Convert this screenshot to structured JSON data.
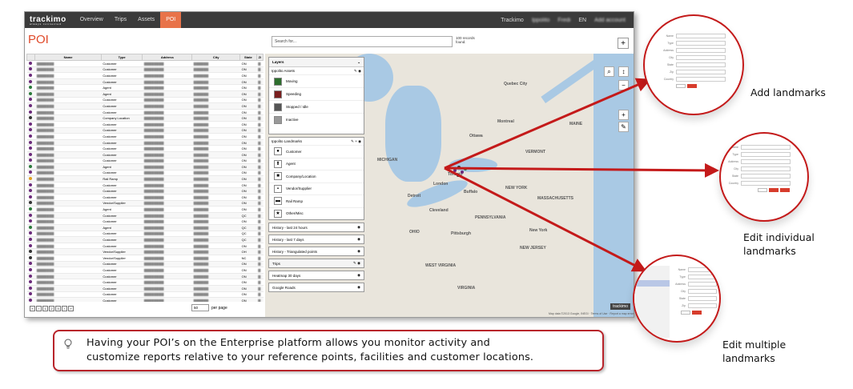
{
  "app": {
    "logo": "trackimo",
    "logo_sub": "always connected",
    "nav": [
      "Overview",
      "Trips",
      "Assets",
      "POI"
    ],
    "topbar_right": [
      "Trackimo",
      "Ippolito",
      "Fredi",
      "EN",
      "Add account"
    ],
    "page_title": "POI",
    "search_placeholder": "Search for...",
    "records": "100 records found.",
    "add_label": "+"
  },
  "table": {
    "headers": [
      "",
      "Name",
      "Type",
      "Address",
      "City",
      "State",
      "Zi"
    ],
    "rows": [
      {
        "color": "#6b2a7a",
        "type": "Customer",
        "state": "ON"
      },
      {
        "color": "#6b2a7a",
        "type": "Customer",
        "state": "ON"
      },
      {
        "color": "#6b2a7a",
        "type": "Customer",
        "state": "ON"
      },
      {
        "color": "#6b2a7a",
        "type": "Customer",
        "state": "ON"
      },
      {
        "color": "#2a7a3a",
        "type": "Agent",
        "state": "ON"
      },
      {
        "color": "#2a7a3a",
        "type": "Agent",
        "state": "ON"
      },
      {
        "color": "#6b2a7a",
        "type": "Customer",
        "state": "ON"
      },
      {
        "color": "#6b2a7a",
        "type": "Customer",
        "state": "ON"
      },
      {
        "color": "#6b2a7a",
        "type": "Customer",
        "state": "ON"
      },
      {
        "color": "#333333",
        "type": "Company Location",
        "state": "ON"
      },
      {
        "color": "#6b2a7a",
        "type": "Customer",
        "state": "ON"
      },
      {
        "color": "#6b2a7a",
        "type": "Customer",
        "state": "ON"
      },
      {
        "color": "#6b2a7a",
        "type": "Customer",
        "state": "ON"
      },
      {
        "color": "#6b2a7a",
        "type": "Customer",
        "state": "ON"
      },
      {
        "color": "#6b2a7a",
        "type": "Customer",
        "state": "ON"
      },
      {
        "color": "#6b2a7a",
        "type": "Customer",
        "state": "ON"
      },
      {
        "color": "#6b2a7a",
        "type": "Customer",
        "state": "ON"
      },
      {
        "color": "#2a7a3a",
        "type": "Agent",
        "state": "ON"
      },
      {
        "color": "#6b2a7a",
        "type": "Customer",
        "state": "ON"
      },
      {
        "color": "#e2a020",
        "type": "Rail Ramp",
        "state": "ON"
      },
      {
        "color": "#6b2a7a",
        "type": "Customer",
        "state": "ON"
      },
      {
        "color": "#6b2a7a",
        "type": "Customer",
        "state": "ON"
      },
      {
        "color": "#6b2a7a",
        "type": "Customer",
        "state": "ON"
      },
      {
        "color": "#333333",
        "type": "Vendor/Supplier",
        "state": "ON"
      },
      {
        "color": "#2a7a3a",
        "type": "Agent",
        "state": "ON"
      },
      {
        "color": "#6b2a7a",
        "type": "Customer",
        "state": "QC"
      },
      {
        "color": "#6b2a7a",
        "type": "Customer",
        "state": "ON"
      },
      {
        "color": "#2a7a3a",
        "type": "Agent",
        "state": "QC"
      },
      {
        "color": "#6b2a7a",
        "type": "Customer",
        "state": "QC"
      },
      {
        "color": "#6b2a7a",
        "type": "Customer",
        "state": "QC"
      },
      {
        "color": "#6b2a7a",
        "type": "Customer",
        "state": "ON"
      },
      {
        "color": "#333333",
        "type": "Vendor/Supplier",
        "state": "OH"
      },
      {
        "color": "#333333",
        "type": "Vendor/Supplier",
        "state": "NC"
      },
      {
        "color": "#6b2a7a",
        "type": "Customer",
        "state": "ON"
      },
      {
        "color": "#6b2a7a",
        "type": "Customer",
        "state": "ON"
      },
      {
        "color": "#6b2a7a",
        "type": "Customer",
        "state": "ON"
      },
      {
        "color": "#6b2a7a",
        "type": "Customer",
        "state": "ON"
      },
      {
        "color": "#6b2a7a",
        "type": "Customer",
        "state": "ON"
      },
      {
        "color": "#6b2a7a",
        "type": "Customer",
        "state": "ON"
      },
      {
        "color": "#6b2a7a",
        "type": "Customer",
        "state": "ON"
      }
    ]
  },
  "pager": {
    "pages": [
      "«",
      "‹",
      "1",
      "2",
      "3",
      "›",
      "»"
    ],
    "per_page": "50",
    "per_page_label": "per page"
  },
  "layers": {
    "title": "Layers",
    "assets_group": "Ippolito Assets",
    "assets": [
      "Moving",
      "Speeding",
      "Stopped / Idle",
      "Inactive"
    ],
    "landmarks_group": "Ippolito Landmarks",
    "landmarks": [
      "Customer",
      "Agent",
      "Company/Location",
      "Vendor/Supplier",
      "Rail Ramp",
      "Other/Misc"
    ],
    "history": [
      "History - last 24 hours",
      "History - last 7 days",
      "History - Triangulated points"
    ],
    "trips": "Trips",
    "heatmap": "Heatmap 30 days",
    "roads": "Google Roads"
  },
  "map": {
    "labels": [
      "Quebec City",
      "Montreal",
      "Ottawa",
      "Toronto",
      "Buffalo",
      "Cleveland",
      "Pittsburgh",
      "NEW YORK",
      "New York",
      "PENNSYLVANIA",
      "OHIO",
      "VIRGINIA",
      "MAINE",
      "VERMONT",
      "MASSACHUSETTS",
      "NEW JERSEY",
      "WEST VIRGINIA",
      "MICHIGAN",
      "Detroit",
      "London"
    ],
    "attribution": "Map data ©2013 Google, INEGI · Terms of Use · Report a map error",
    "watermark": "trackimo"
  },
  "callouts": {
    "add": "Add landmarks",
    "edit_individual": [
      "Edit individual",
      "landmarks"
    ],
    "edit_multiple": [
      "Edit multiple",
      "landmarks"
    ]
  },
  "info": {
    "line1": "Having your POI’s on the Enterprise platform allows you monitor activity and",
    "line2": "customize reports relative to your reference points, facilities and customer locations."
  },
  "colors": {
    "accent": "#e8734a",
    "title_red": "#e04a2a",
    "arrow": "#c41a1a",
    "box_border": "#b8232a"
  }
}
